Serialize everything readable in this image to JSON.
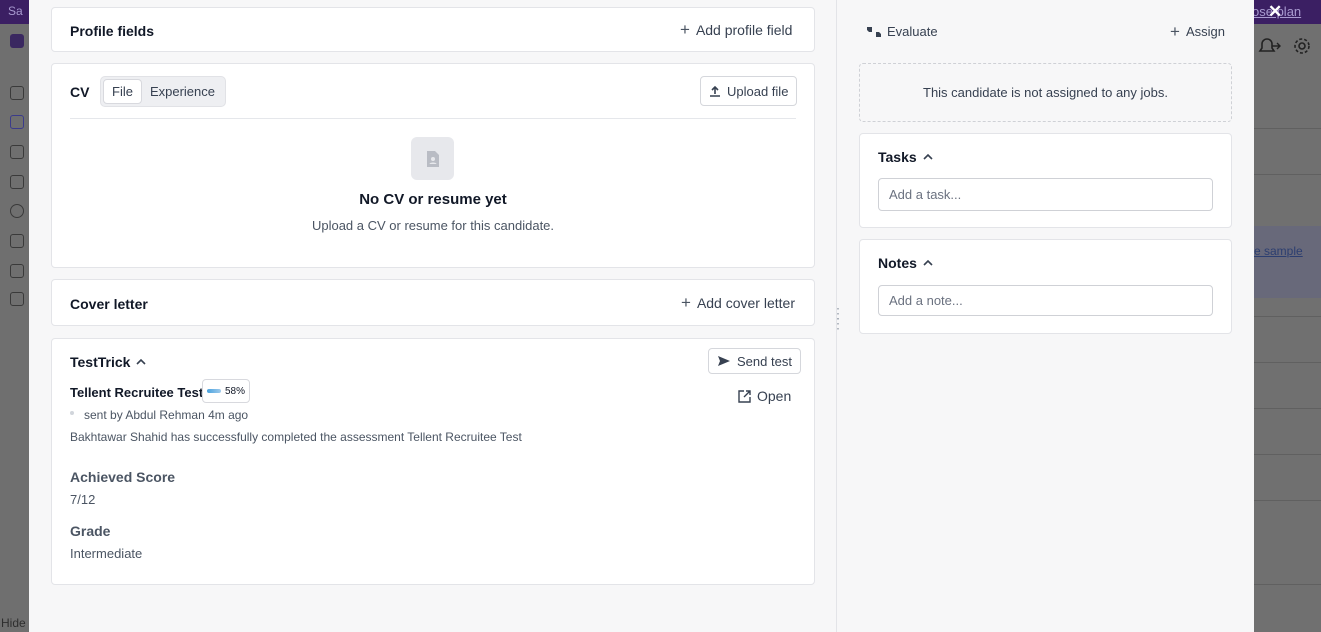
{
  "background": {
    "topbar_left": "Sa",
    "topbar_right": "ose plan",
    "sidebar_bottom": "Hide",
    "right_link": "e sample"
  },
  "modal": {
    "left": {
      "profile_fields": {
        "title": "Profile fields",
        "add_label": "Add profile field"
      },
      "cv": {
        "title": "CV",
        "tabs": [
          {
            "label": "File",
            "active": true
          },
          {
            "label": "Experience",
            "active": false
          }
        ],
        "upload_label": "Upload file",
        "empty_title": "No CV or resume yet",
        "empty_subtitle": "Upload a CV or resume for this candidate."
      },
      "cover_letter": {
        "title": "Cover letter",
        "add_label": "Add cover letter"
      },
      "testtrick": {
        "title": "TestTrick",
        "send_label": "Send test",
        "test_name": "Tellent Recruitee Test",
        "badge_percent": "58%",
        "open_label": "Open",
        "sent_by": "sent by Abdul Rehman 4m ago",
        "message": "Bakhtawar Shahid has successfully completed the assessment Tellent Recruitee Test",
        "score_label": "Achieved Score",
        "score_value": "7/12",
        "grade_label": "Grade",
        "grade_value": "Intermediate"
      }
    },
    "right": {
      "evaluate_label": "Evaluate",
      "assign_label": "Assign",
      "not_assigned": "This candidate is not assigned to any jobs.",
      "tasks": {
        "title": "Tasks",
        "placeholder": "Add a task..."
      },
      "notes": {
        "title": "Notes",
        "placeholder": "Add a note..."
      }
    }
  },
  "icons": {
    "close": "close-icon",
    "bell": "bell-icon",
    "settings": "gear-icon"
  }
}
